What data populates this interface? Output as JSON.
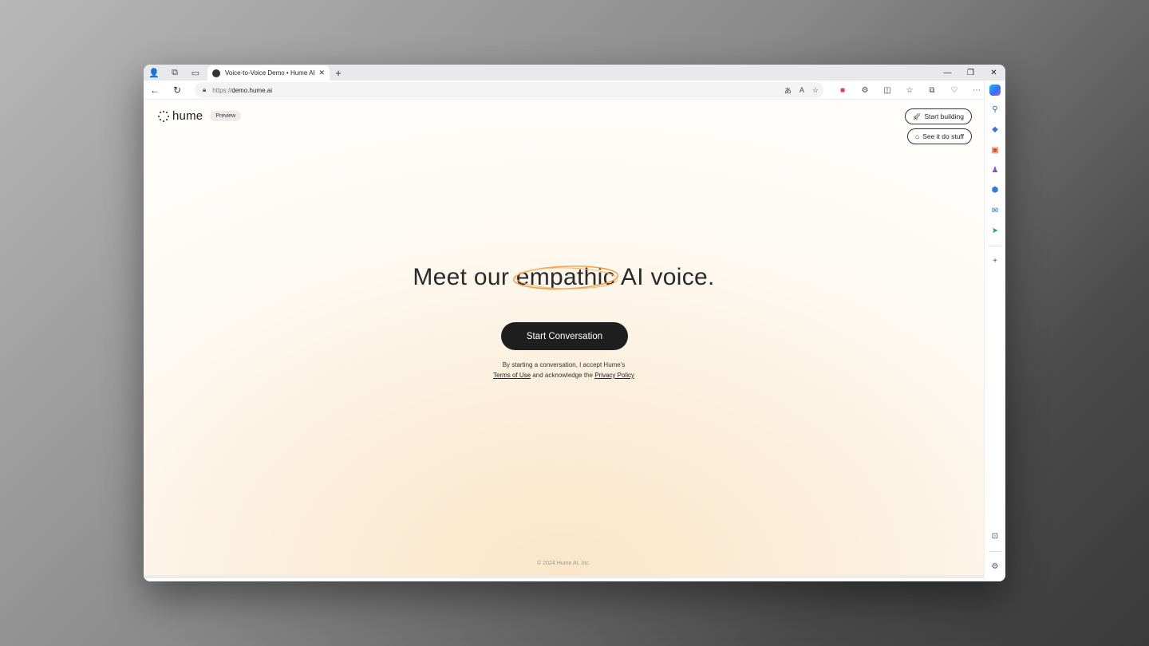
{
  "browser": {
    "tab_title": "Voice-to-Voice Demo • Hume AI",
    "tab_close": "✕",
    "new_tab": "+",
    "url_protocol": "https://",
    "url_host": "demo.hume.ai",
    "window_controls": [
      "—",
      "❐",
      "✕"
    ]
  },
  "page": {
    "logo_text": "hume",
    "preview_badge": "Preview",
    "start_building": "Start building",
    "see_it_do_stuff": "See it do stuff",
    "headline_before": "Meet our ",
    "headline_emph": "empathic",
    "headline_after": " AI voice.",
    "cta": "Start Conversation",
    "legal_line1": "By starting a conversation, I accept Hume's",
    "terms_link": "Terms of Use",
    "legal_mid": " and acknowledge the ",
    "privacy_link": "Privacy Policy",
    "footer": "© 2024 Hume AI, Inc."
  },
  "colors": {
    "accent_orange": "#f0a04a",
    "button_dark": "#1f1f1f"
  }
}
